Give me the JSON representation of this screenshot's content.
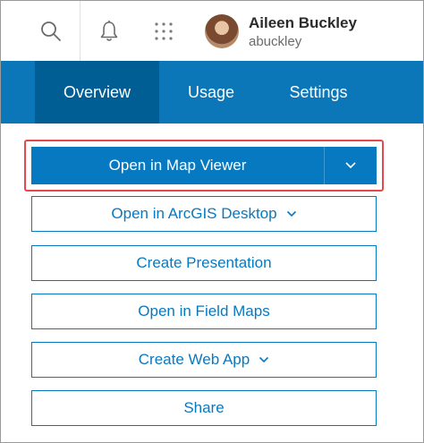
{
  "header": {
    "user": {
      "name": "Aileen Buckley",
      "username": "abuckley"
    },
    "icons": [
      "search-icon",
      "bell-icon",
      "apps-grid-icon",
      "avatar"
    ]
  },
  "tabs": [
    {
      "label": "Overview",
      "active": true
    },
    {
      "label": "Usage",
      "active": false
    },
    {
      "label": "Settings",
      "active": false
    }
  ],
  "actions": {
    "primary": {
      "label": "Open in Map Viewer",
      "has_dropdown": true,
      "highlighted": true
    },
    "buttons": [
      {
        "label": "Open in ArcGIS Desktop",
        "has_dropdown": true
      },
      {
        "label": "Create Presentation",
        "has_dropdown": false
      },
      {
        "label": "Open in Field Maps",
        "has_dropdown": false
      },
      {
        "label": "Create Web App",
        "has_dropdown": true
      },
      {
        "label": "Share",
        "has_dropdown": false
      }
    ]
  },
  "colors": {
    "brand_blue": "#0779c1",
    "tabbar_blue": "#0b76b8",
    "active_tab": "#005e95",
    "highlight_red": "#e5484d"
  }
}
